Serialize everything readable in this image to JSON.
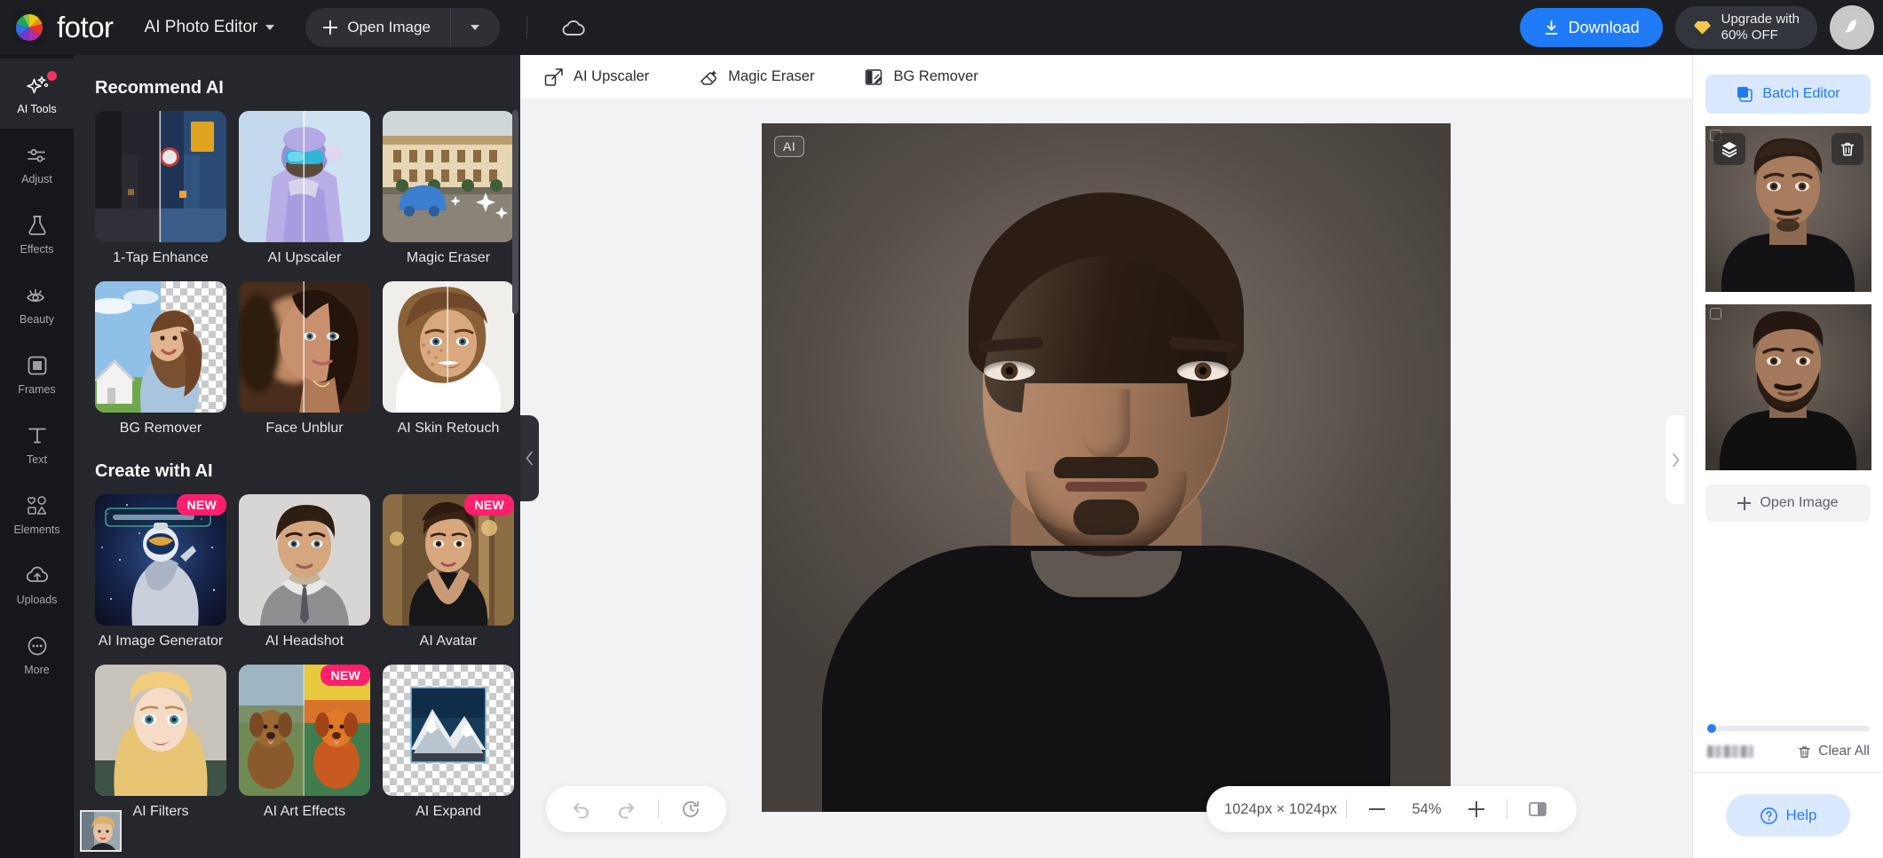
{
  "header": {
    "brand": "fotor",
    "mode_label": "AI Photo Editor",
    "open_image_label": "Open Image",
    "download_label": "Download",
    "upgrade_line1": "Upgrade with",
    "upgrade_line2": "60% OFF",
    "cloud_icon": "cloud-icon",
    "caret_icon": "chevron-down-icon",
    "avatar_icon": "avatar-bird-icon"
  },
  "rail": {
    "items": [
      {
        "label": "AI Tools",
        "icon": "sparkle-icon",
        "active": true,
        "dot": true
      },
      {
        "label": "Adjust",
        "icon": "sliders-icon",
        "active": false,
        "dot": false
      },
      {
        "label": "Effects",
        "icon": "flask-icon",
        "active": false,
        "dot": false
      },
      {
        "label": "Beauty",
        "icon": "eye-icon",
        "active": false,
        "dot": false
      },
      {
        "label": "Frames",
        "icon": "frame-icon",
        "active": false,
        "dot": false
      },
      {
        "label": "Text",
        "icon": "text-t-icon",
        "active": false,
        "dot": false
      },
      {
        "label": "Elements",
        "icon": "shapes-icon",
        "active": false,
        "dot": false
      },
      {
        "label": "Uploads",
        "icon": "cloud-upload-icon",
        "active": false,
        "dot": false
      },
      {
        "label": "More",
        "icon": "ellipsis-icon",
        "active": false,
        "dot": false
      }
    ]
  },
  "toolpanel": {
    "section1_title": "Recommend AI",
    "section2_title": "Create with AI",
    "recommend": [
      {
        "label": "1-Tap Enhance",
        "thumb": "street-night-split",
        "badge": ""
      },
      {
        "label": "AI Upscaler",
        "thumb": "skier-split",
        "badge": ""
      },
      {
        "label": "Magic Eraser",
        "thumb": "building-car-erase",
        "badge": ""
      },
      {
        "label": "BG Remover",
        "thumb": "woman-checker-bg",
        "badge": ""
      },
      {
        "label": "Face Unblur",
        "thumb": "face-blur-split",
        "badge": ""
      },
      {
        "label": "AI Skin Retouch",
        "thumb": "skin-retouch-split",
        "badge": ""
      }
    ],
    "create": [
      {
        "label": "AI Image Generator",
        "thumb": "astronaut-unicorn",
        "badge": "NEW"
      },
      {
        "label": "AI Headshot",
        "thumb": "suit-headshot",
        "badge": ""
      },
      {
        "label": "AI Avatar",
        "thumb": "gown-avatar",
        "badge": "NEW"
      },
      {
        "label": "AI Filters",
        "thumb": "anime-filter",
        "badge": ""
      },
      {
        "label": "AI Art Effects",
        "thumb": "dog-art-split",
        "badge": "NEW"
      },
      {
        "label": "AI Expand",
        "thumb": "mountain-expand",
        "badge": ""
      }
    ]
  },
  "subbar": {
    "items": [
      {
        "label": "AI Upscaler",
        "icon": "upscale-icon"
      },
      {
        "label": "Magic Eraser",
        "icon": "eraser-icon"
      },
      {
        "label": "BG Remover",
        "icon": "bg-remove-icon"
      }
    ]
  },
  "canvas": {
    "ai_chip": "AI",
    "collapse_left_icon": "chevron-left-icon",
    "collapse_right_icon": "chevron-right-icon"
  },
  "bottombar": {
    "undo_icon": "undo-icon",
    "redo_icon": "redo-icon",
    "history_icon": "history-reset-icon",
    "dimensions": "1024px × 1024px",
    "zoom_out_icon": "minus-icon",
    "zoom_level": "54%",
    "zoom_in_icon": "plus-icon",
    "compare_icon": "compare-split-icon"
  },
  "rightpanel": {
    "batch_editor_label": "Batch Editor",
    "batch_icon": "layers-stack-icon",
    "thumbnails": [
      {
        "name": "portrait-clean-shaven",
        "selected": true,
        "layers_icon": "layers-icon",
        "delete_icon": "trash-icon"
      },
      {
        "name": "portrait-bearded",
        "selected": false,
        "layers_icon": "layers-icon",
        "delete_icon": "trash-icon"
      }
    ],
    "open_image_label": "Open Image",
    "clear_all_label": "Clear All",
    "clear_all_icon": "trash-icon",
    "help_label": "Help",
    "help_icon": "question-circle-icon"
  },
  "colors": {
    "accent_blue": "#1f7bf5",
    "badge_pink": "#ff1f6d",
    "panel_dark": "#26272c",
    "rail_dark": "#16171a",
    "header_dark": "#1d1e22",
    "notification_dot": "#f5335e"
  }
}
